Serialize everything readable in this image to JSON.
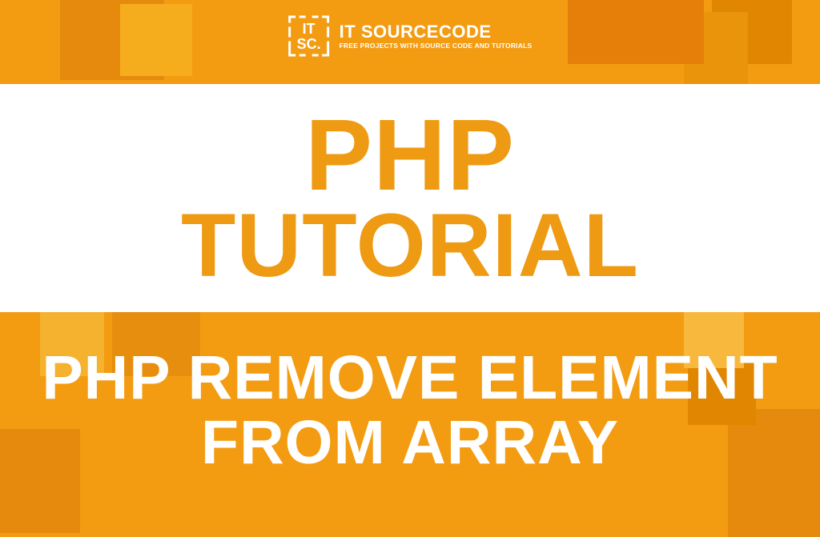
{
  "logo": {
    "title": "IT SOURCECODE",
    "subtitle": "FREE PROJECTS WITH SOURCE CODE AND TUTORIALS",
    "icon_text_top": "IT",
    "icon_text_bottom": "SC."
  },
  "main": {
    "line1": "PHP",
    "line2": "TUTORIAL"
  },
  "subtitle": {
    "line1": "PHP REMOVE ELEMENT",
    "line2": "FROM ARRAY"
  }
}
